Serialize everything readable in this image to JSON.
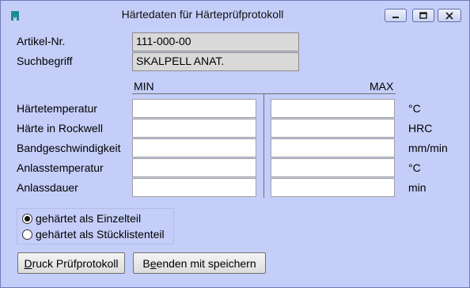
{
  "window": {
    "title": "Härtedaten für Härteprüfprotokoll"
  },
  "header": {
    "artikel_label": "Artikel-Nr.",
    "artikel_value": "111-000-00",
    "suchbegriff_label": "Suchbegriff",
    "suchbegriff_value": "SKALPELL ANAT."
  },
  "columns": {
    "min": "MIN",
    "max": "MAX"
  },
  "rows": [
    {
      "label": "Härtetemperatur",
      "unit": "°C",
      "min": "",
      "max": ""
    },
    {
      "label": "Härte in Rockwell",
      "unit": "HRC",
      "min": "",
      "max": ""
    },
    {
      "label": "Bandgeschwindigkeit",
      "unit": "mm/min",
      "min": "",
      "max": ""
    },
    {
      "label": "Anlasstemperatur",
      "unit": "°C",
      "min": "",
      "max": ""
    },
    {
      "label": "Anlassdauer",
      "unit": "min",
      "min": "",
      "max": ""
    }
  ],
  "radio": {
    "option1": "gehärtet als Einzelteil",
    "option2": "gehärtet als Stücklistenteil",
    "selected": "option1"
  },
  "buttons": {
    "print_prefix": "D",
    "print_rest": "ruck Prüfprotokoll",
    "exit_prefix": "B",
    "exit_mid": "e",
    "exit_rest": "enden mit speichern"
  },
  "colors": {
    "background": "#c5cef8",
    "readonly_field": "#d9d9d9",
    "icon_accent": "#1f8c8c"
  },
  "icons": {
    "app": "bookmark-icon",
    "minimize": "minimize-icon",
    "maximize": "maximize-icon",
    "close": "close-icon"
  }
}
